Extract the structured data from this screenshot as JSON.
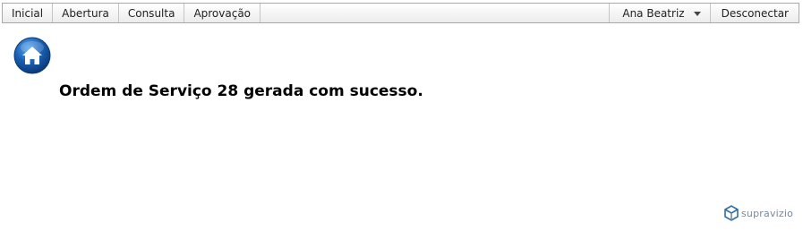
{
  "nav": {
    "items": [
      {
        "label": "Inicial"
      },
      {
        "label": "Abertura"
      },
      {
        "label": "Consulta"
      },
      {
        "label": "Aprovação"
      }
    ],
    "user_name": "Ana Beatriz",
    "logout_label": "Desconectar"
  },
  "main": {
    "home_icon": "home-icon",
    "message": "Ordem de Serviço 28 gerada com sucesso."
  },
  "footer": {
    "brand": "supravizio"
  },
  "colors": {
    "home_icon_blue": "#1a5fb4",
    "brand_blue": "#2f6ea8",
    "brand_gray": "#7a8a99"
  }
}
